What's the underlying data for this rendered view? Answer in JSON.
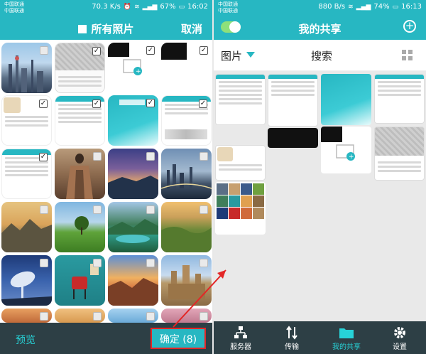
{
  "left_screen": {
    "status": {
      "carrier1": "中国联通",
      "carrier2": "中国联通",
      "speed": "70.3 K/s",
      "battery": "67%",
      "time": "16:02"
    },
    "appbar": {
      "title": "所有照片",
      "cancel": "取消"
    },
    "bottom": {
      "preview": "预览",
      "confirm": "确定 (8)"
    }
  },
  "right_screen": {
    "status": {
      "carrier1": "中国联通",
      "carrier2": "中国联通",
      "speed": "880 B/s",
      "battery": "74%",
      "time": "16:13"
    },
    "appbar": {
      "title": "我的共享",
      "plus": "+"
    },
    "filter": {
      "category": "图片",
      "search": "搜索"
    },
    "nav": [
      {
        "label": "服务器",
        "icon": "server-icon"
      },
      {
        "label": "传输",
        "icon": "transfer-icon"
      },
      {
        "label": "我的共享",
        "icon": "folder-icon"
      },
      {
        "label": "设置",
        "icon": "gear-icon"
      }
    ]
  },
  "colors": {
    "accent": "#27b7c2",
    "nav_bg": "#2d3f45",
    "highlight": "#e32626",
    "active": "#27d3d8"
  }
}
